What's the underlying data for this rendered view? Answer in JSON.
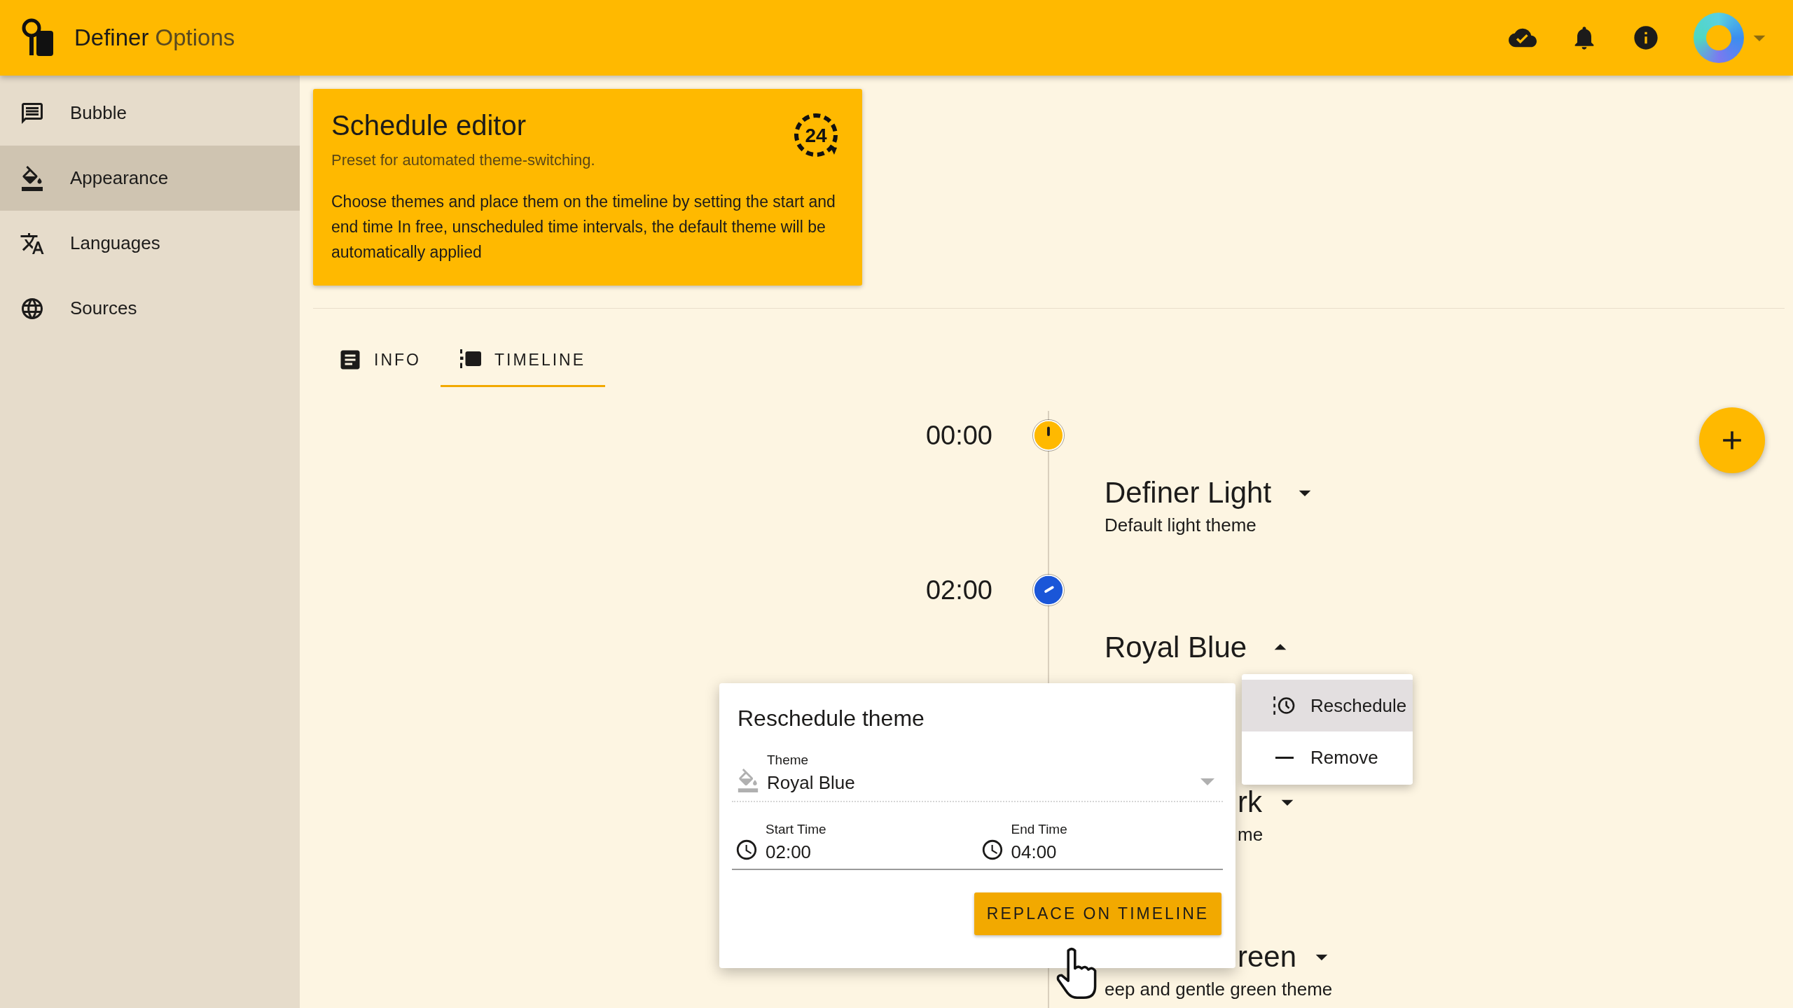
{
  "app_bar": {
    "title": "Definer",
    "subtitle": "Options"
  },
  "sidebar": {
    "items": [
      {
        "label": "Bubble",
        "selected": false
      },
      {
        "label": "Appearance",
        "selected": true
      },
      {
        "label": "Languages",
        "selected": false
      },
      {
        "label": "Sources",
        "selected": false
      }
    ]
  },
  "card": {
    "title": "Schedule editor",
    "subtitle": "Preset for automated theme-switching.",
    "body": "Choose themes and place them on the timeline by setting the start and end time In free, unscheduled time intervals, the default theme will be automatically applied",
    "icon_label": "24"
  },
  "tabs": [
    {
      "label": "INFO",
      "selected": false
    },
    {
      "label": "TIMELINE",
      "selected": true
    }
  ],
  "timeline": {
    "entries": [
      {
        "kind": "time",
        "time": "00:00",
        "color": "#ffb900"
      },
      {
        "kind": "theme",
        "title": "Definer Light",
        "description": "Default light theme",
        "expanded": false
      },
      {
        "kind": "time",
        "time": "02:00",
        "color": "#1a56d8"
      },
      {
        "kind": "theme",
        "title": "Royal Blue",
        "expanded": true
      },
      {
        "kind": "theme",
        "title": "rk",
        "description": "me",
        "expanded": false,
        "title_covered": true,
        "description_covered": true
      },
      {
        "kind": "theme",
        "title": "reen",
        "description": "eep and gentle green theme",
        "expanded": false,
        "title_covered": true,
        "description_covered": false
      }
    ]
  },
  "context_menu": {
    "items": [
      {
        "label": "Reschedule",
        "selected": true
      },
      {
        "label": "Remove",
        "selected": false
      }
    ]
  },
  "dialog": {
    "title": "Reschedule theme",
    "theme_field": {
      "label": "Theme",
      "value": "Royal Blue",
      "disabled": true
    },
    "start_time": {
      "label": "Start Time",
      "value": "02:00"
    },
    "end_time": {
      "label": "End Time",
      "value": "04:00"
    },
    "button": "REPLACE ON TIMELINE"
  }
}
